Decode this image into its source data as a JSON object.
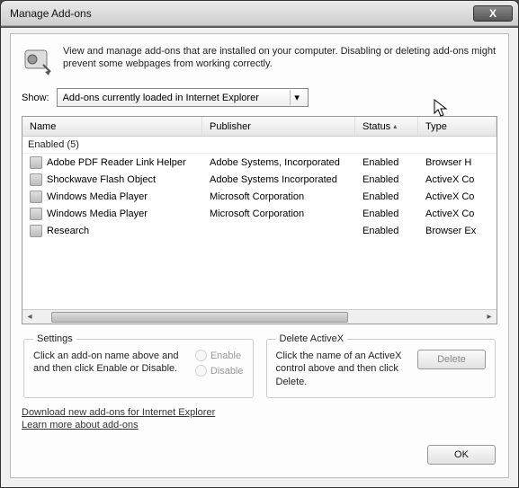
{
  "window": {
    "title": "Manage Add-ons"
  },
  "intro": {
    "text": "View and manage add-ons that are installed on your computer. Disabling or deleting add-ons might prevent some webpages from working correctly."
  },
  "show": {
    "label": "Show:",
    "selected": "Add-ons currently loaded in Internet Explorer"
  },
  "columns": {
    "name": "Name",
    "publisher": "Publisher",
    "status": "Status",
    "type": "Type"
  },
  "group_label": "Enabled (5)",
  "rows": [
    {
      "name": "Adobe PDF Reader Link Helper",
      "publisher": "Adobe Systems, Incorporated",
      "status": "Enabled",
      "type": "Browser H"
    },
    {
      "name": "Shockwave Flash Object",
      "publisher": "Adobe Systems Incorporated",
      "status": "Enabled",
      "type": "ActiveX Co"
    },
    {
      "name": "Windows Media Player",
      "publisher": "Microsoft Corporation",
      "status": "Enabled",
      "type": "ActiveX Co"
    },
    {
      "name": "Windows Media Player",
      "publisher": "Microsoft Corporation",
      "status": "Enabled",
      "type": "ActiveX Co"
    },
    {
      "name": "Research",
      "publisher": "",
      "status": "Enabled",
      "type": "Browser Ex"
    }
  ],
  "settings": {
    "legend": "Settings",
    "text": "Click an add-on name above and and then click Enable or Disable.",
    "enable_label": "Enable",
    "disable_label": "Disable"
  },
  "deletex": {
    "legend": "Delete ActiveX",
    "text": "Click the name of an ActiveX control above and then click Delete.",
    "button": "Delete"
  },
  "links": {
    "download": "Download new add-ons for Internet Explorer",
    "learn": "Learn more about add-ons"
  },
  "footer": {
    "ok": "OK"
  }
}
